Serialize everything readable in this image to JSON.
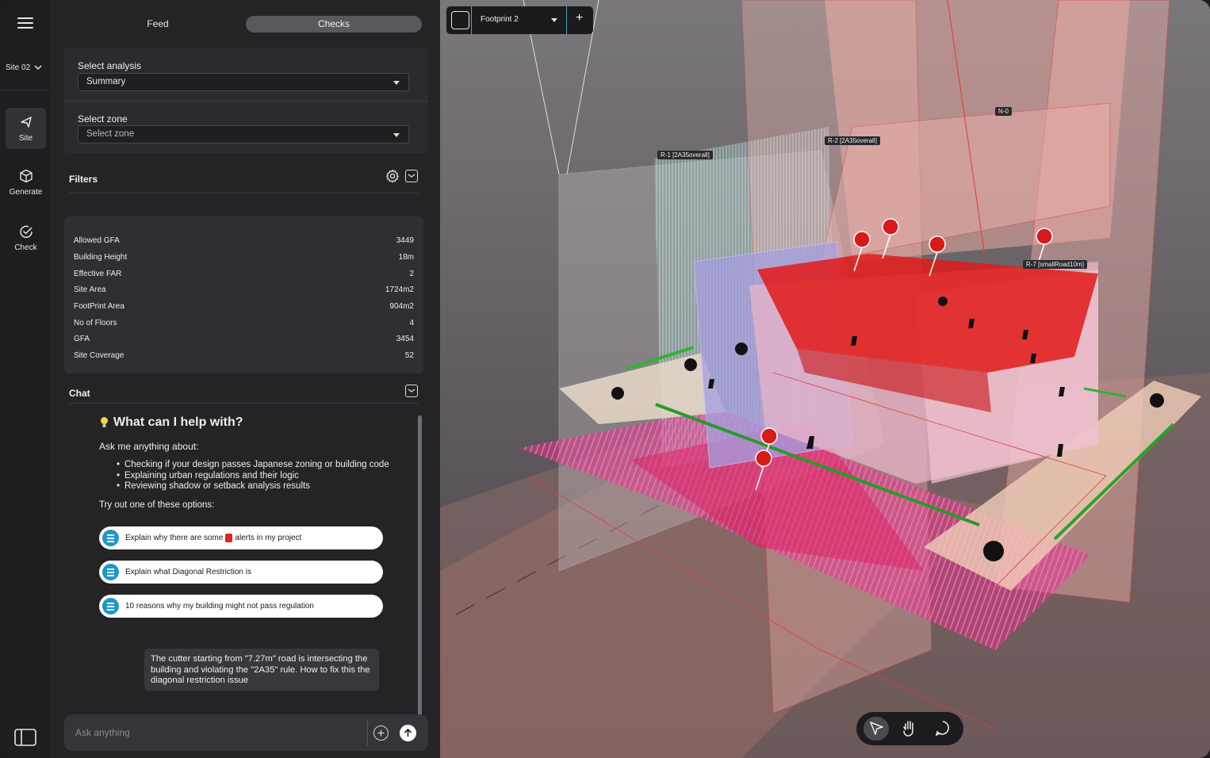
{
  "rail": {
    "site": "Site 02",
    "items": [
      {
        "label": "Site",
        "icon": "pin-cursor-icon"
      },
      {
        "label": "Generate",
        "icon": "cube-icon"
      },
      {
        "label": "Check",
        "icon": "check-circle-icon"
      }
    ]
  },
  "tabs": [
    {
      "label": "Feed"
    },
    {
      "label": "Checks"
    }
  ],
  "analysis": {
    "label": "Select analysis",
    "value": "Summary"
  },
  "zone": {
    "label": "Select zone",
    "placeholder": "Select zone"
  },
  "filters": {
    "title": "Filters"
  },
  "stats": [
    {
      "label": "Allowed GFA",
      "value": "3449"
    },
    {
      "label": "Building Height",
      "value": "18m"
    },
    {
      "label": "Effective FAR",
      "value": "2"
    },
    {
      "label": "Site Area",
      "value": "1724m2"
    },
    {
      "label": "FootPrint Area",
      "value": "904m2"
    },
    {
      "label": "No of Floors",
      "value": "4"
    },
    {
      "label": "GFA",
      "value": "3454"
    },
    {
      "label": "Site Coverage",
      "value": "52"
    }
  ],
  "chat": {
    "title": "Chat",
    "help_title": "What can I help with?",
    "ask_line": "Ask me anything about:",
    "bullets": [
      "Checking if your design passes Japanese zoning or building code",
      "Explaining urban regulations and their logic",
      "Reviewing shadow or setback analysis results"
    ],
    "tryout": "Try out one of these options:",
    "suggestions": [
      {
        "before": "Explain why there are some",
        "after": "alerts in my project"
      },
      {
        "before": "Explain what Diagonal Restriction is",
        "after": ""
      },
      {
        "before": "10 reasons why my building might not pass regulation",
        "after": ""
      }
    ],
    "message": "The cutter starting from \"7.27m\" road is intersecting the building and violating the \"2A35\" rule. How to fix this the diagonal restriction issue",
    "input_placeholder": "Ask anything"
  },
  "viewport": {
    "footprint": "Footprint 2",
    "tags": {
      "r1": "R-1 [2A35overall]",
      "r2": "R-2 [2A35overall]",
      "n0": "N-0",
      "r7": "R-7 [smallRoad10m]"
    }
  },
  "colors": {
    "accent": "#1f98c9",
    "alert": "#e2231a"
  }
}
